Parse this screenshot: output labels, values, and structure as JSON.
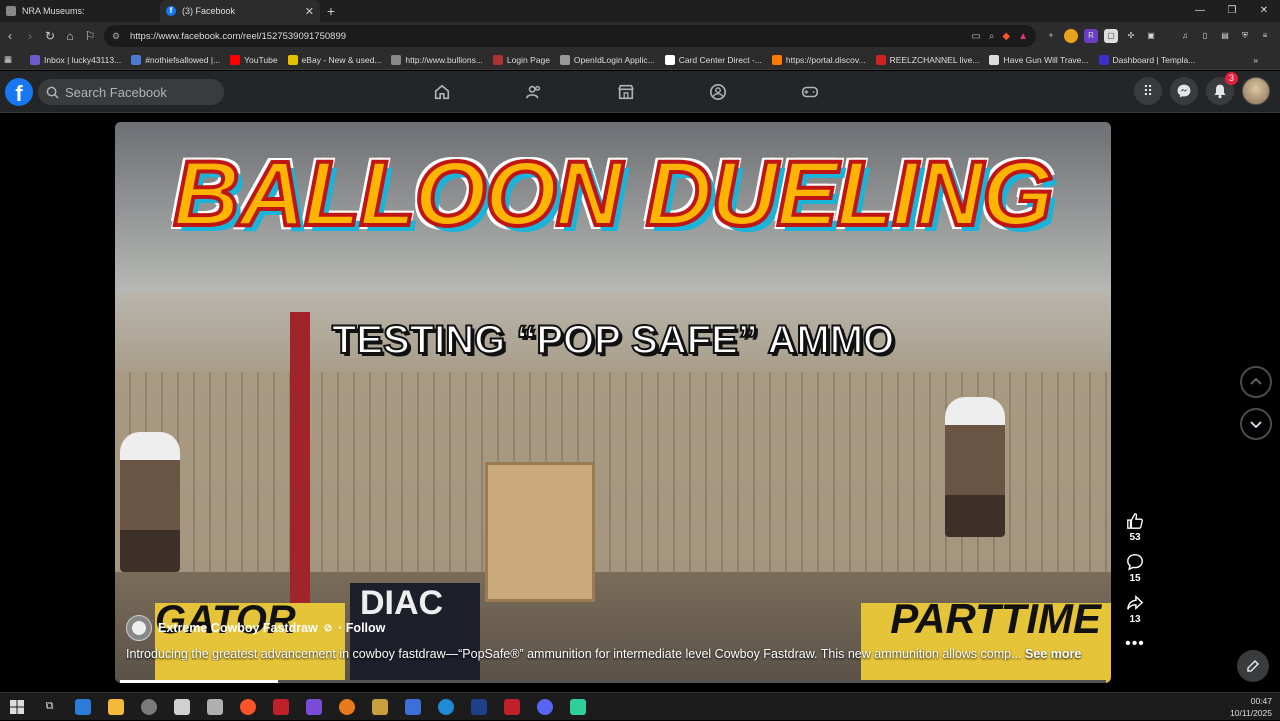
{
  "browser": {
    "tabs": [
      {
        "title": "NRA Museums:"
      },
      {
        "title": "(3) Facebook"
      }
    ],
    "url": "https://www.facebook.com/reel/1527539091750899",
    "bookmarks": [
      {
        "label": "Inbox | lucky43113...",
        "color": "#6a5acd"
      },
      {
        "label": "#nothiefsallowed |...",
        "color": "#4a7bd0"
      },
      {
        "label": "YouTube",
        "color": "#ff0000"
      },
      {
        "label": "eBay - New & used...",
        "color": "#e6c300"
      },
      {
        "label": "http://www.bullions...",
        "color": "#888888"
      },
      {
        "label": "Login Page",
        "color": "#aa3333"
      },
      {
        "label": "OpenIdLogin Applic...",
        "color": "#999999"
      },
      {
        "label": "Card Center Direct -...",
        "color": "#ffffff"
      },
      {
        "label": "https://portal.discov...",
        "color": "#ff7a00"
      },
      {
        "label": "REELZCHANNEL live...",
        "color": "#cc2222"
      },
      {
        "label": "Have Gun Will Trave...",
        "color": "#dddddd"
      },
      {
        "label": "Dashboard | Templa...",
        "color": "#3b2fc9"
      }
    ]
  },
  "facebook": {
    "search_placeholder": "Search Facebook",
    "notifications_count": "3"
  },
  "reel": {
    "title_main": "BALLOON DUELING",
    "title_sub": "TESTING “POP SAFE” AMMO",
    "banner_left": "GATOR",
    "banner_mid": "DIAC",
    "banner_right": "PARTTIME",
    "owner": "Extreme Cowboy Fastdraw",
    "follow": "· Follow",
    "caption": "Introducing the greatest advancement in cowboy fastdraw—“PopSafe®” ammunition for intermediate level Cowboy Fastdraw.  This new ammunition allows comp...",
    "see_more": "See more",
    "likes": "53",
    "comments": "15",
    "shares": "13",
    "progress": 0.16
  },
  "taskbar": {
    "time": "00:47",
    "date": "10/11/2025",
    "icons": [
      "#2b7bd8",
      "#f2b93a",
      "#7a7a7a",
      "#d0d0d0",
      "#b0b0b0",
      "#fb542b",
      "#c0202a",
      "#7a4bd6",
      "#e87a1c",
      "#c8a040",
      "#3c6fd8",
      "#1f8bd6",
      "#1e3f8a",
      "#c0202a",
      "#5865f2",
      "#2ecf9a"
    ]
  }
}
